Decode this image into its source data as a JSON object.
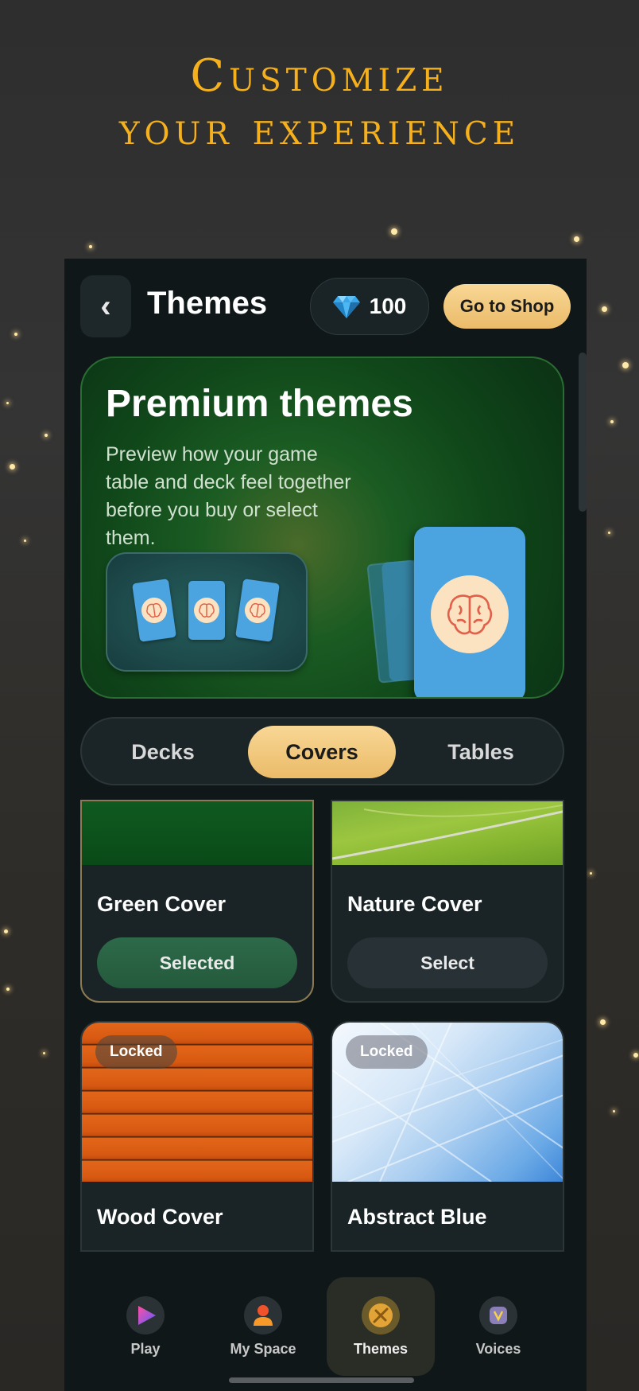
{
  "headline": {
    "line1": "Customize",
    "line2": "your experience"
  },
  "header": {
    "title": "Themes",
    "back_icon": "‹",
    "gems": "100",
    "shop_label": "Go to Shop"
  },
  "hero": {
    "title": "Premium themes",
    "description": "Preview how your game table and deck feel together before you buy or select them."
  },
  "tabs": [
    {
      "label": "Decks",
      "active": false
    },
    {
      "label": "Covers",
      "active": true
    },
    {
      "label": "Tables",
      "active": false
    }
  ],
  "covers": [
    {
      "name": "Green Cover",
      "button": "Selected",
      "state": "selected"
    },
    {
      "name": "Nature Cover",
      "button": "Select",
      "state": "available"
    },
    {
      "name": "Wood Cover",
      "badge": "Locked",
      "state": "locked"
    },
    {
      "name": "Abstract Blue",
      "badge": "Locked",
      "state": "locked"
    }
  ],
  "nav": [
    {
      "label": "Play",
      "icon": "play-icon",
      "active": false
    },
    {
      "label": "My Space",
      "icon": "person-icon",
      "active": false
    },
    {
      "label": "Themes",
      "icon": "brush-icon",
      "active": true
    },
    {
      "label": "Voices",
      "icon": "voice-icon",
      "active": false
    }
  ],
  "colors": {
    "headline": "#f5b01c",
    "accent_gold": "#ebbb69",
    "card_blue": "#4ba3df",
    "selected_green": "#2d6a49"
  }
}
